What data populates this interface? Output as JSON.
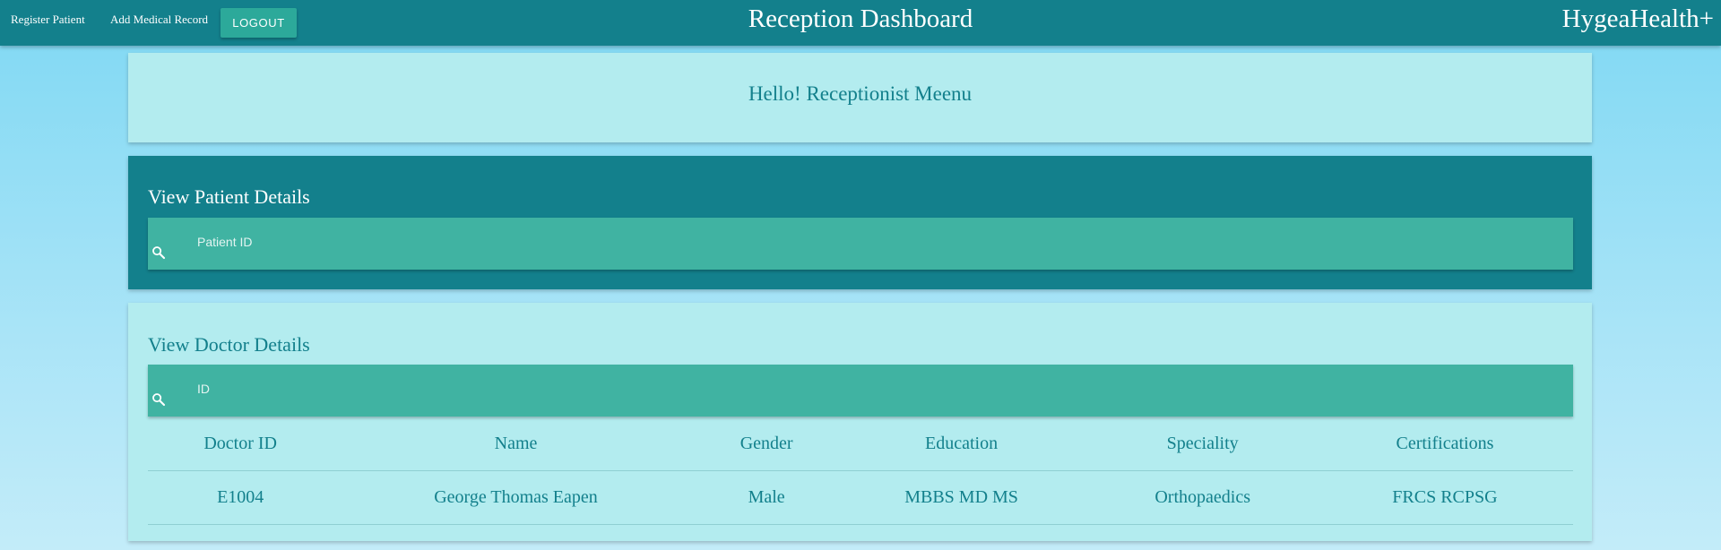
{
  "navbar": {
    "register_patient": "Register Patient",
    "add_medical_record": "Add Medical Record",
    "logout": "LOGOUT",
    "title": "Reception Dashboard",
    "brand": "HygeaHealth+"
  },
  "greeting": "Hello! Receptionist Meenu",
  "patient_section": {
    "heading": "View Patient Details",
    "search_placeholder": "Patient ID",
    "search_icon": "search-icon"
  },
  "doctor_section": {
    "heading": "View Doctor Details",
    "search_placeholder": "ID",
    "search_icon": "search-icon",
    "columns": [
      "Doctor ID",
      "Name",
      "Gender",
      "Education",
      "Speciality",
      "Certifications"
    ],
    "rows": [
      [
        "E1004",
        "George Thomas Eapen",
        "Male",
        "MBBS MD MS",
        "Orthopaedics",
        "FRCS RCPSG"
      ]
    ]
  },
  "colors": {
    "primary": "#13808c",
    "accent": "#40b3a2",
    "card_light": "#b3ecef",
    "button": "#2ca99a"
  }
}
